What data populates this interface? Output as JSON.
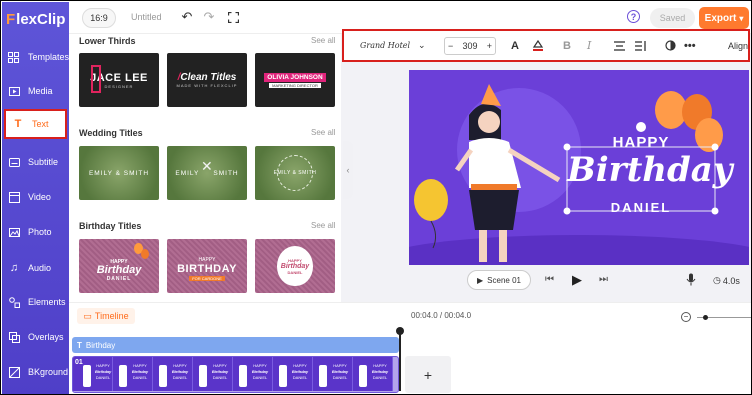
{
  "app": {
    "logo": "lexClip",
    "logo_f": "F"
  },
  "sidebar": {
    "items": [
      {
        "label": "Templates",
        "icon": "templates-icon"
      },
      {
        "label": "Media",
        "icon": "media-icon"
      },
      {
        "label": "Text",
        "icon": "text-icon",
        "active": true
      },
      {
        "label": "Subtitle",
        "icon": "subtitle-icon"
      },
      {
        "label": "Video",
        "icon": "video-icon"
      },
      {
        "label": "Photo",
        "icon": "photo-icon"
      },
      {
        "label": "Audio",
        "icon": "audio-icon"
      },
      {
        "label": "Elements",
        "icon": "elements-icon"
      },
      {
        "label": "Overlays",
        "icon": "overlays-icon"
      },
      {
        "label": "BKground",
        "icon": "background-icon"
      }
    ]
  },
  "topbar": {
    "ratio": "16:9",
    "title": "Untitled",
    "help": "?",
    "saved": "Saved",
    "export": "Export",
    "export_chevron": "▾"
  },
  "library": {
    "sections": [
      {
        "title": "Lower Thirds",
        "see_all": "See all"
      },
      {
        "title": "Wedding Titles",
        "see_all": "See all"
      },
      {
        "title": "Birthday Titles",
        "see_all": "See all"
      }
    ],
    "lower_thirds": [
      {
        "main": "JACE LEE",
        "sub": "DESIGNER"
      },
      {
        "main": "Clean Titles",
        "sub": "MADE WITH FLEXCLIP"
      },
      {
        "main": "OLIVIA JOHNSON",
        "sub": "MARKETING DIRECTOR"
      }
    ],
    "wedding": [
      {
        "main": "EMILY & SMITH"
      },
      {
        "main": "EMILY",
        "main2": "SMITH"
      },
      {
        "main": "EMILY & SMITH"
      }
    ],
    "birthday": [
      {
        "l1": "HAPPY",
        "l2": "Birthday",
        "l3": "DANIEL"
      },
      {
        "l1": "HAPPY",
        "l2": "BIRTHDAY",
        "l3": "FOR CARDONE"
      },
      {
        "l1": "HAPPY",
        "l2": "Birthday",
        "l3": "DANIEL"
      }
    ]
  },
  "text_toolbar": {
    "font": "Grand Hotel",
    "font_size": "309",
    "minus": "−",
    "plus": "+",
    "align": "Align"
  },
  "stage": {
    "line1": "HAPPY",
    "line2": "Birthday",
    "line3": "DANIEL"
  },
  "scene": {
    "label": "Scene 01",
    "duration": "4.0s"
  },
  "timeline": {
    "tab": "Timeline",
    "time": "00:04.0 / 00:04.0",
    "text_track": "Birthday",
    "clip_index": "01",
    "frame_line1": "HAPPY",
    "frame_line2": "Birthday",
    "frame_line3": "DANIEL",
    "add": "+"
  },
  "colors": {
    "sidebar": "#5e55d8",
    "accent": "#ff7a2e",
    "stage_bg": "#6b3fd8",
    "highlight": "#d8201d"
  }
}
